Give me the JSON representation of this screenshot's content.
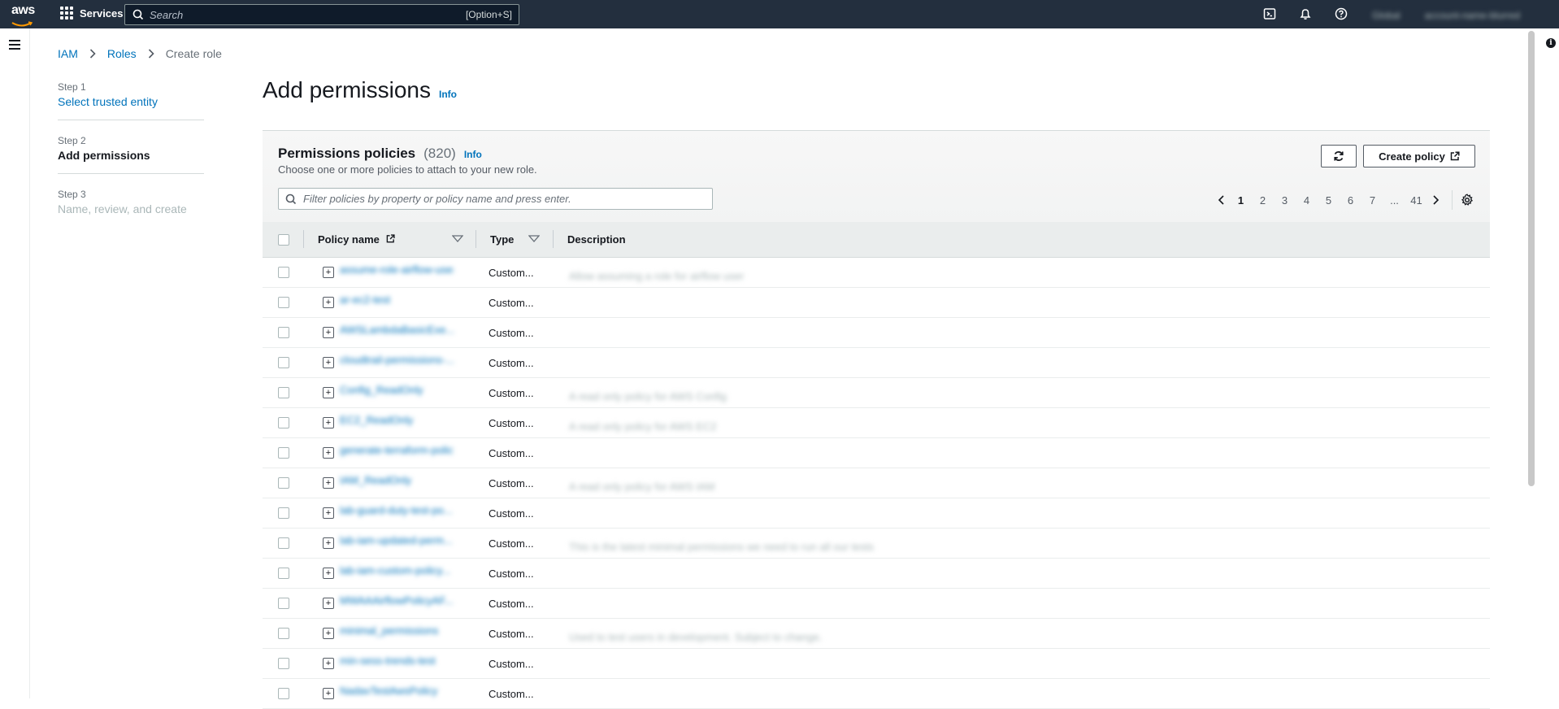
{
  "topbar": {
    "brand": "aws",
    "services_label": "Services",
    "search_placeholder": "Search",
    "search_hint": "[Option+S]",
    "region_label": "Global",
    "account_label": "account-name-blurred"
  },
  "breadcrumb": [
    {
      "label": "IAM"
    },
    {
      "label": "Roles"
    },
    {
      "label": "Create role"
    }
  ],
  "steps": [
    {
      "step": "Step 1",
      "name": "Select trusted entity"
    },
    {
      "step": "Step 2",
      "name": "Add permissions"
    },
    {
      "step": "Step 3",
      "name": "Name, review, and create"
    }
  ],
  "page": {
    "title": "Add permissions",
    "info": "Info"
  },
  "panel": {
    "title": "Permissions policies",
    "count": "(820)",
    "info": "Info",
    "description": "Choose one or more policies to attach to your new role.",
    "create_policy_label": "Create policy",
    "filter_placeholder": "Filter policies by property or policy name and press enter."
  },
  "pagination": {
    "pages": [
      "1",
      "2",
      "3",
      "4",
      "5",
      "6",
      "7",
      "...",
      "41"
    ],
    "current": "1"
  },
  "table": {
    "headers": {
      "name": "Policy name",
      "type": "Type",
      "description": "Description"
    },
    "rows": [
      {
        "name": "assume-role-airflow-user",
        "type": "Custom...",
        "description": "Allow assuming a role for airflow user"
      },
      {
        "name": "ar-ec2-test",
        "type": "Custom...",
        "description": ""
      },
      {
        "name": "AWSLambdaBasicExe...",
        "type": "Custom...",
        "description": ""
      },
      {
        "name": "cloudtrail-permissions-...",
        "type": "Custom...",
        "description": ""
      },
      {
        "name": "Config_ReadOnly",
        "type": "Custom...",
        "description": "A read only policy for AWS Config"
      },
      {
        "name": "EC2_ReadOnly",
        "type": "Custom...",
        "description": "A read only policy for AWS EC2"
      },
      {
        "name": "generate-terraform-policy",
        "type": "Custom...",
        "description": ""
      },
      {
        "name": "IAM_ReadOnly",
        "type": "Custom...",
        "description": "A read only policy for AWS IAM"
      },
      {
        "name": "lab-guard-duty-test-po...",
        "type": "Custom...",
        "description": ""
      },
      {
        "name": "lab-iam-updated-perm...",
        "type": "Custom...",
        "description": "This is the latest minimal permissions we need to run all our tests"
      },
      {
        "name": "lab-iam-custom-policy...",
        "type": "Custom...",
        "description": ""
      },
      {
        "name": "MWAAAirflowPolicyAF...",
        "type": "Custom...",
        "description": ""
      },
      {
        "name": "minimal_permissions",
        "type": "Custom...",
        "description": "Used to test users in development. Subject to change."
      },
      {
        "name": "min-sess-trends-test",
        "type": "Custom...",
        "description": ""
      },
      {
        "name": "NadavTestAwsPolicy",
        "type": "Custom...",
        "description": ""
      }
    ]
  }
}
